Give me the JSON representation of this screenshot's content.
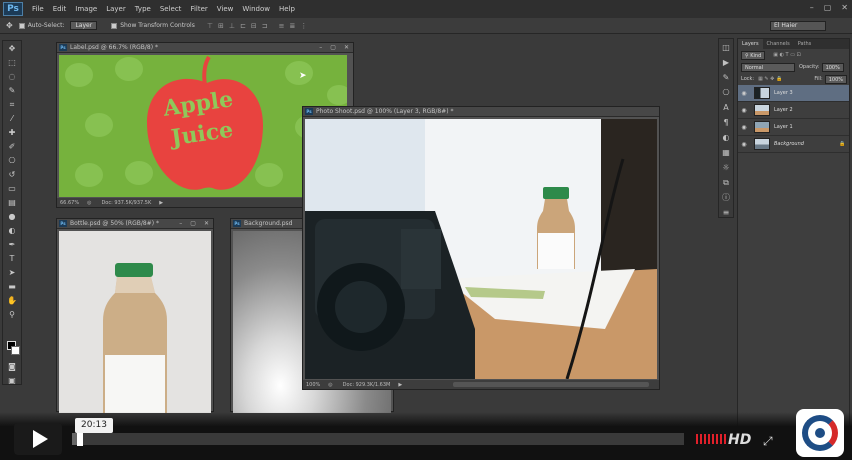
{
  "app": {
    "logo": "Ps"
  },
  "menu": [
    "File",
    "Edit",
    "Image",
    "Layer",
    "Type",
    "Select",
    "Filter",
    "View",
    "Window",
    "Help"
  ],
  "window_controls": [
    "–",
    "▢",
    "✕"
  ],
  "options_bar": {
    "auto_select_label": "Auto-Select:",
    "auto_select_value": "Layer",
    "show_transform_label": "Show Transform Controls",
    "workspace": "El Haier"
  },
  "docs": {
    "label": {
      "title": "Label.psd @ 66.7% (RGB/8) *",
      "zoom": "66.67%",
      "doc_size": "Doc: 937.5K/937.5K",
      "headline_1": "Apple",
      "headline_2": "Juice",
      "pattern_text": "Apple Juice"
    },
    "bottle": {
      "title": "Bottle.psd @ 50% (RGB/8#) *"
    },
    "background": {
      "title": "Background.psd"
    },
    "photo": {
      "title": "Photo Shoot.psd @ 100% (Layer 3, RGB/8#) *",
      "zoom": "100%",
      "doc_size": "Doc: 929.3K/1.63M"
    }
  },
  "layers_panel": {
    "tabs": [
      "Layers",
      "Channels",
      "Paths"
    ],
    "kind": "Kind",
    "blend_mode": "Normal",
    "opacity_label": "Opacity:",
    "opacity": "100%",
    "lock_label": "Lock:",
    "fill_label": "Fill:",
    "fill": "100%",
    "layers": [
      {
        "name": "Layer 3",
        "active": true
      },
      {
        "name": "Layer 2",
        "active": false
      },
      {
        "name": "Layer 1",
        "active": false
      },
      {
        "name": "Background",
        "active": false,
        "locked": true
      }
    ]
  },
  "player": {
    "time": "20:13",
    "progress_fraction": 0.013,
    "hd_label": "HD",
    "accent": "#e0202a"
  },
  "colors": {
    "label_green": "#76b23d",
    "apple_red": "#e8433f",
    "bottle_cap": "#2e8a4a"
  }
}
